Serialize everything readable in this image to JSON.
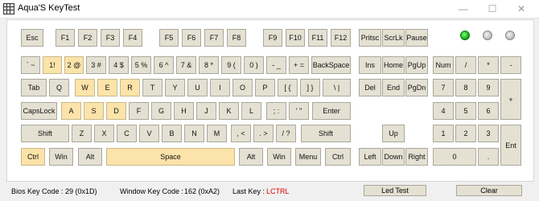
{
  "window": {
    "title": "Aqua'S KeyTest",
    "minimize": "—",
    "maximize": "☐",
    "close": "✕"
  },
  "keyboard": {
    "function_row": [
      "Esc",
      "F1",
      "F2",
      "F3",
      "F4",
      "F5",
      "F6",
      "F7",
      "F8",
      "F9",
      "F10",
      "F11",
      "F12"
    ],
    "number_row": [
      "` ~",
      "1!",
      "2 @",
      "3 #",
      "4 $",
      "5 %",
      "6 ^",
      "7 &",
      "8 *",
      "9 (",
      "0 )",
      "- _",
      "+ =",
      "BackSpace"
    ],
    "qwerty_row": [
      "Tab",
      "Q",
      "W",
      "E",
      "R",
      "T",
      "Y",
      "U",
      "I",
      "O",
      "P",
      "[ {",
      "] }",
      "\\ |"
    ],
    "home_row": [
      "CapsLock",
      "A",
      "S",
      "D",
      "F",
      "G",
      "H",
      "J",
      "K",
      "L",
      ";  :",
      "' \"",
      "Enter"
    ],
    "shift_row": [
      "Shift",
      "Z",
      "X",
      "C",
      "V",
      "B",
      "N",
      "M",
      ", <",
      ". >",
      "/ ?",
      "Shift"
    ],
    "bottom_row": [
      "Ctrl",
      "Win",
      "Alt",
      "Space",
      "Alt",
      "Win",
      "Menu",
      "Ctrl"
    ],
    "system_keys": [
      "Pritsc",
      "ScrLk",
      "Pause"
    ],
    "nav_upper": [
      "Ins",
      "Home",
      "PgUp"
    ],
    "nav_lower": [
      "Del",
      "End",
      "PgDn"
    ],
    "arrows": [
      "Up",
      "Left",
      "Down",
      "Right"
    ],
    "numpad": {
      "row1": [
        "Num",
        "/",
        "*",
        "-"
      ],
      "row2": [
        "7",
        "8",
        "9"
      ],
      "plus": "+",
      "row3": [
        "4",
        "5",
        "6"
      ],
      "row4": [
        "1",
        "2",
        "3"
      ],
      "enter": "Ent",
      "zero": "0",
      "dot": "."
    },
    "pressed_keys": [
      "1!",
      "2 @",
      "W",
      "E",
      "R",
      "A",
      "S",
      "D",
      "Ctrl",
      "Space"
    ],
    "colors": {
      "key": "#e4e1d3",
      "pressed": "#fbe3a9"
    }
  },
  "leds": [
    {
      "name": "num-lock",
      "state": "on",
      "color": "#1cc41c"
    },
    {
      "name": "caps-lock",
      "state": "off"
    },
    {
      "name": "scroll-lock",
      "state": "off"
    }
  ],
  "status": {
    "bios_label": "Bios Key Code :",
    "bios_value": "29 (0x1D)",
    "window_label": "Window Key Code :",
    "window_value": "162 (0xA2)",
    "last_label": "Last Key :",
    "last_value": "LCTRL",
    "led_test_button": "Led Test",
    "clear_button": "Clear"
  }
}
